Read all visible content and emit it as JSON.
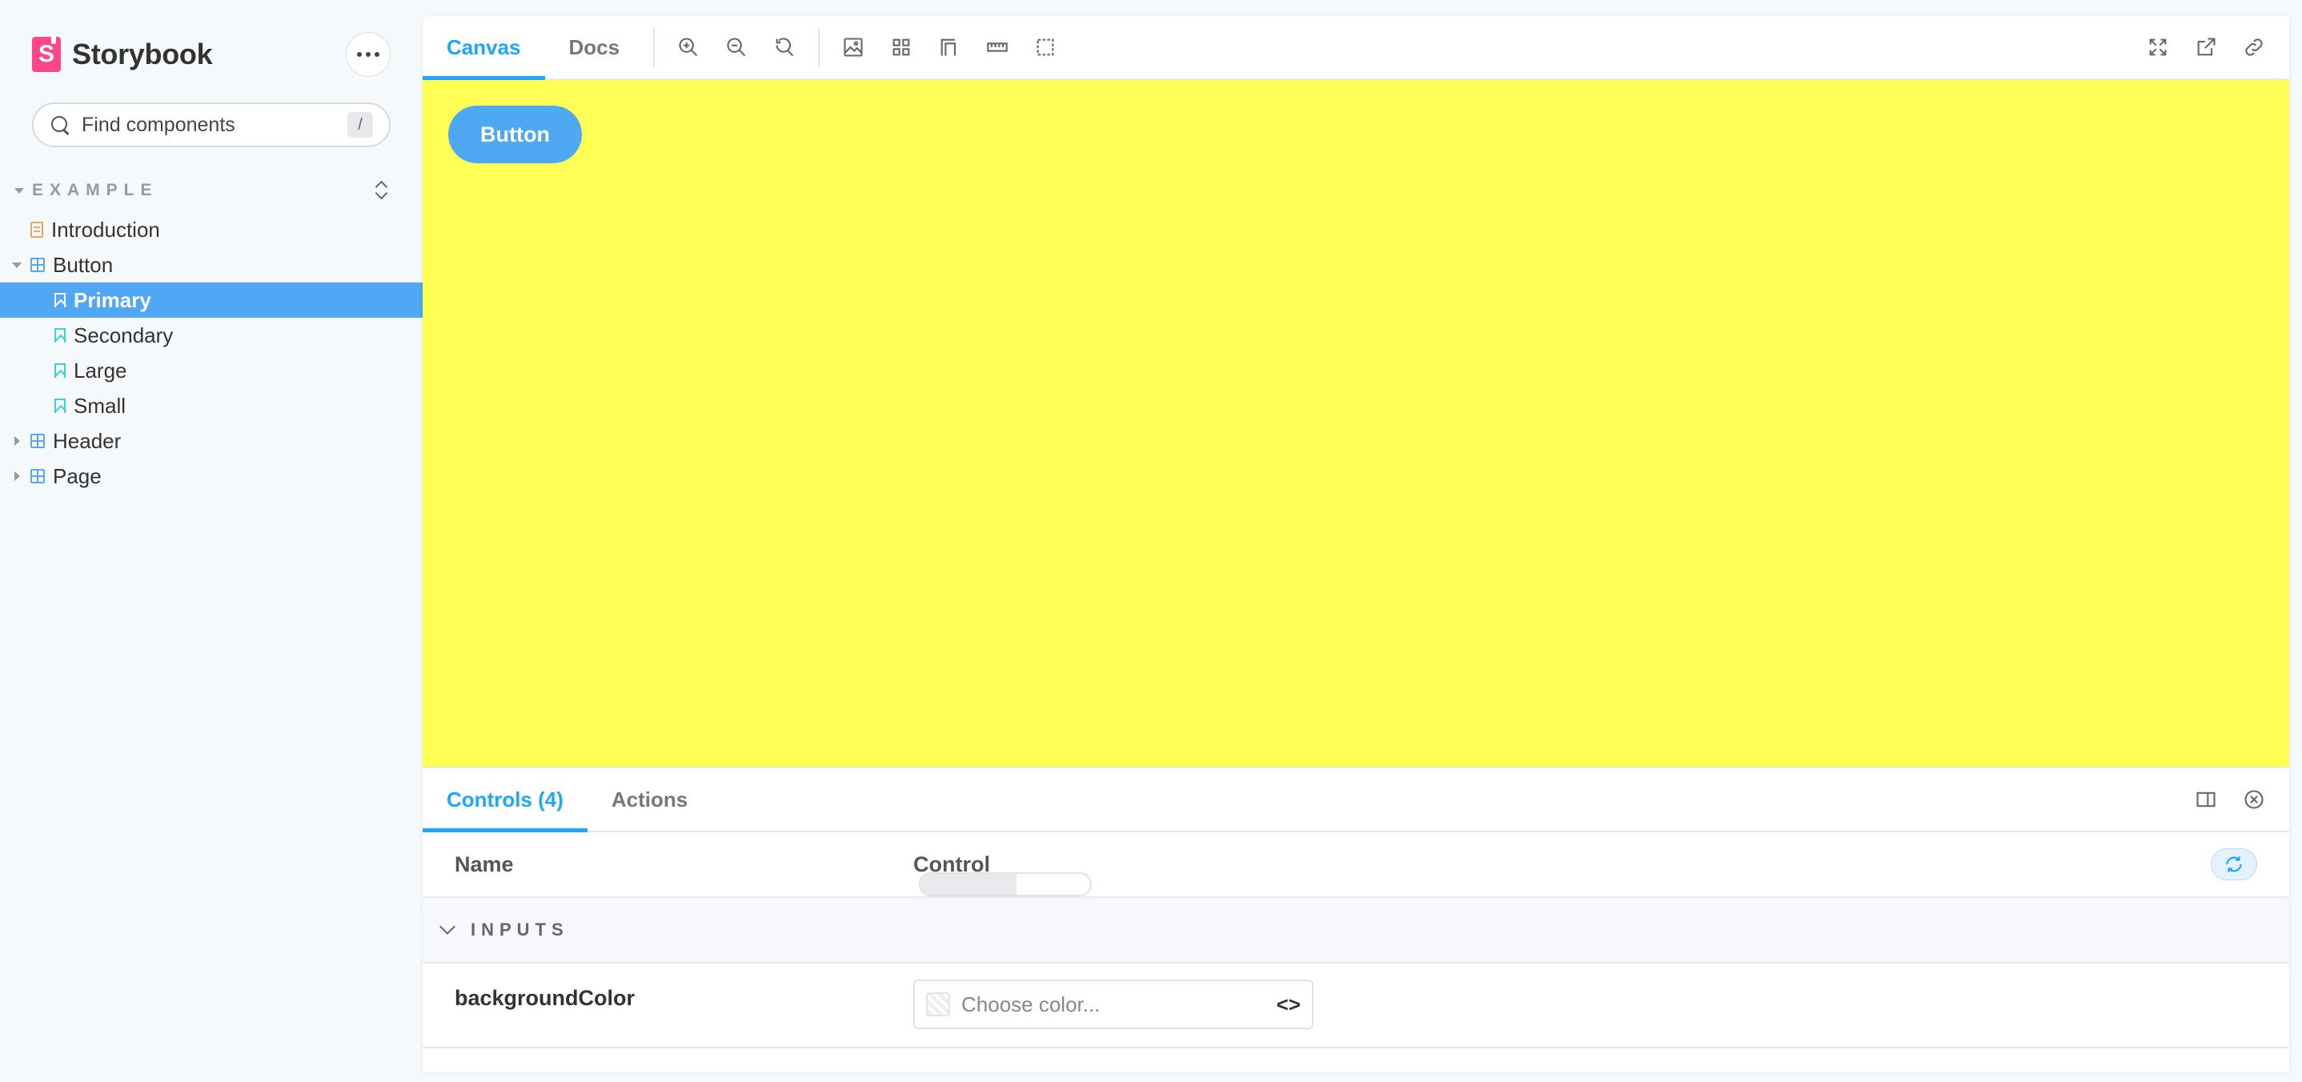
{
  "brand": {
    "name": "Storybook",
    "logo_letter": "S",
    "color": "#ff4785"
  },
  "search": {
    "placeholder": "Find components",
    "shortcut": "/"
  },
  "sidebar": {
    "section_title": "EXAMPLE",
    "items": [
      {
        "label": "Introduction",
        "type": "doc"
      },
      {
        "label": "Button",
        "type": "component",
        "expanded": true
      },
      {
        "label": "Primary",
        "type": "story",
        "selected": true
      },
      {
        "label": "Secondary",
        "type": "story"
      },
      {
        "label": "Large",
        "type": "story"
      },
      {
        "label": "Small",
        "type": "story"
      },
      {
        "label": "Header",
        "type": "component",
        "expanded": false
      },
      {
        "label": "Page",
        "type": "component",
        "expanded": false
      }
    ]
  },
  "toolbar": {
    "tabs": [
      {
        "label": "Canvas",
        "active": true
      },
      {
        "label": "Docs",
        "active": false
      }
    ],
    "tools": [
      "zoom-in-icon",
      "zoom-out-icon",
      "zoom-reset-icon",
      "background-icon",
      "grid-icon",
      "viewport-icon",
      "measure-icon",
      "outline-icon"
    ],
    "right_tools": [
      "fullscreen-icon",
      "open-new-tab-icon",
      "copy-link-icon"
    ]
  },
  "canvas": {
    "background": "#ffff55",
    "story_button_label": "Button",
    "story_button_color": "#4ea9f2"
  },
  "addons": {
    "tabs": [
      {
        "label": "Controls (4)",
        "active": true
      },
      {
        "label": "Actions",
        "active": false
      }
    ],
    "table": {
      "col_name": "Name",
      "col_control": "Control",
      "group_label": "INPUTS",
      "rows": [
        {
          "name": "backgroundColor",
          "placeholder": "Choose color...",
          "code_glyph": "<>"
        }
      ]
    }
  },
  "colors": {
    "accent": "#1ea7fd",
    "selected_bg": "#4fa7f5"
  }
}
